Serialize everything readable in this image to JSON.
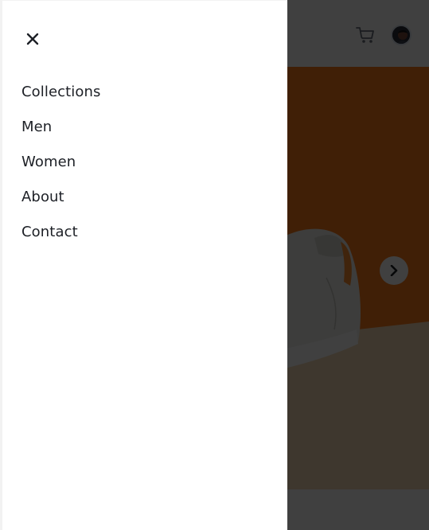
{
  "nav_drawer": {
    "close_icon": "close-icon",
    "items": [
      {
        "label": "Collections"
      },
      {
        "label": "Men"
      },
      {
        "label": "Women"
      },
      {
        "label": "About"
      },
      {
        "label": "Contact"
      }
    ]
  },
  "header": {
    "cart_icon": "cart-icon",
    "avatar_icon": "avatar"
  },
  "hero": {
    "next_icon": "chevron-right-icon"
  },
  "colors": {
    "text": "#1d2026",
    "overlay": "#000000",
    "hero_orange": "#ff7d1a"
  }
}
